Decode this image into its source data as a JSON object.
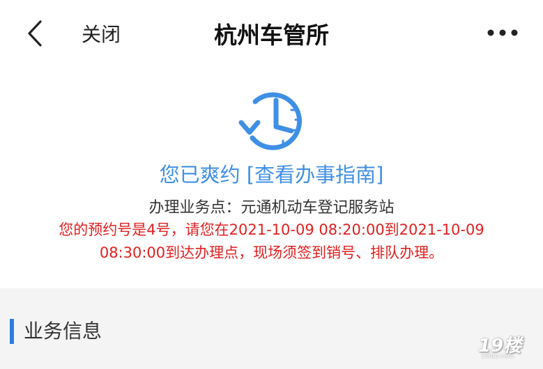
{
  "nav": {
    "close_label": "关闭",
    "title": "杭州车管所"
  },
  "status": {
    "message": "您已爽约",
    "guide_link": "[查看办事指南]",
    "service_point": "办理业务点：元通机动车登记服务站",
    "notice_line1": "您的预约号是4号，请您在2021-10-09 08:20:00到2021-10-09",
    "notice_line2": "08:30:00到达办理点，现场须签到销号、排队办理。"
  },
  "section": {
    "title": "业务信息"
  },
  "watermark": {
    "logo": "19楼",
    "url": "19lou.com"
  },
  "icons": {
    "back": "chevron-left-icon",
    "more": "more-dots-icon",
    "status": "clock-rewind-icon"
  },
  "colors": {
    "accent": "#3f8fe5",
    "alert": "#e02020",
    "section_bar": "#2b7de0"
  }
}
